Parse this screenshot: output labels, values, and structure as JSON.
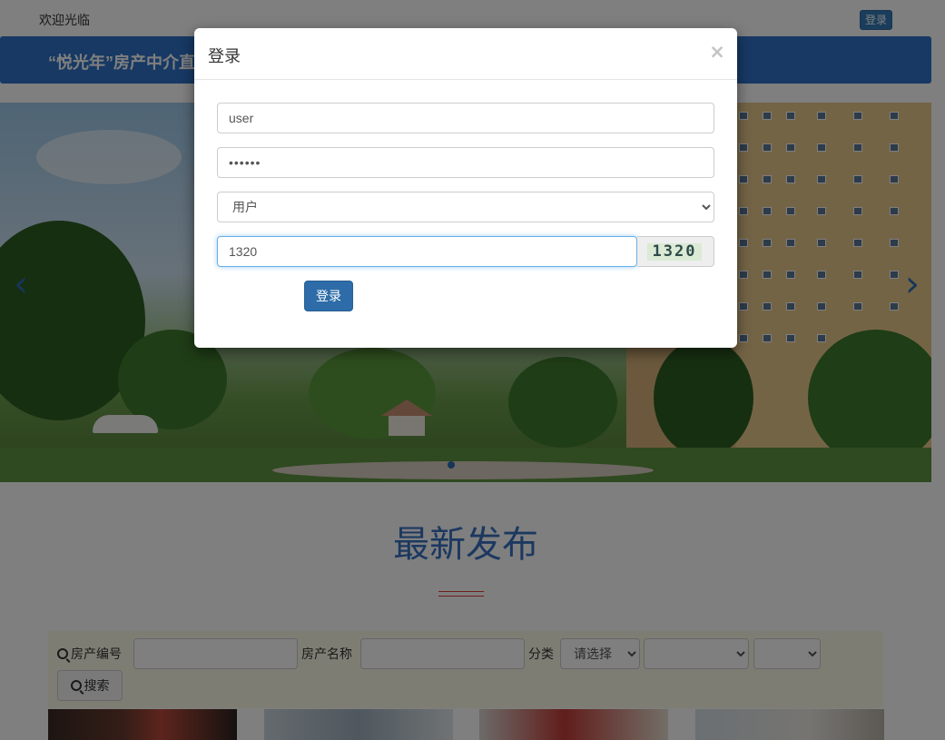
{
  "header": {
    "welcome": "欢迎光临",
    "login_button": "登录"
  },
  "navbar": {
    "brand": "“悦光年”房产中介直"
  },
  "carousel": {
    "prev_icon": "chevron-left-icon",
    "next_icon": "chevron-right-icon"
  },
  "section": {
    "title": "最新发布"
  },
  "search": {
    "code_label": "房产编号",
    "name_label": "房产名称",
    "category_label": "分类",
    "category_select": "请选择",
    "button_label": "搜索",
    "icon": "search-icon"
  },
  "modal": {
    "title": "登录",
    "close_glyph": "×",
    "username_value": "user",
    "password_value": "••••••",
    "role_value": "用户",
    "captcha_value": "1320",
    "captcha_image_text": "1320",
    "submit_label": "登录"
  },
  "colors": {
    "primary": "#2d6ca8",
    "navbar": "#2f73c8",
    "title": "#3871c1",
    "accent_red": "#e23a3a"
  }
}
